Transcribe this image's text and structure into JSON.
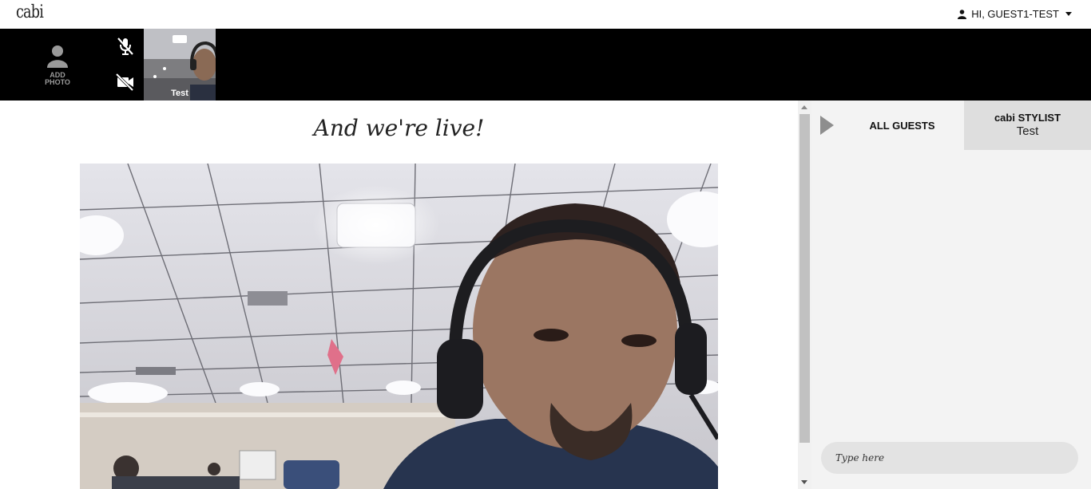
{
  "header": {
    "logo_text": "cabi",
    "user_greeting": "HI, GUEST1-TEST"
  },
  "toolbar": {
    "add_photo_label_1": "ADD",
    "add_photo_label_2": "PHOTO",
    "mic_icon": "mic-muted-icon",
    "camera_icon": "camera-off-icon",
    "participant_name": "Test"
  },
  "main": {
    "title": "And we're live!"
  },
  "sidebar": {
    "tab_all_guests": "ALL GUESTS",
    "tab_stylist_title": "cabi STYLIST",
    "tab_stylist_name": "Test",
    "chat_placeholder": "Type here"
  },
  "colors": {
    "strip": "#000000",
    "panel_bg": "#f3f3f3",
    "active_tab_bg": "#dedede",
    "input_bg": "#e3e3e3"
  }
}
